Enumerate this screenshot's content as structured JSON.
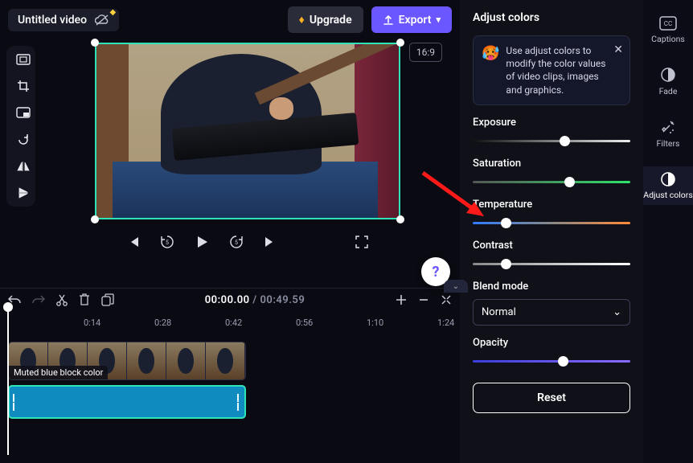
{
  "header": {
    "title": "Untitled video",
    "upgrade_label": "Upgrade",
    "export_label": "Export",
    "aspect_ratio": "16:9"
  },
  "timeline": {
    "current_time": "00:00.00",
    "total_time": "00:49.59",
    "separator": " / ",
    "ticks": [
      "0:14",
      "0:28",
      "0:42",
      "0:56",
      "1:10",
      "1:24"
    ],
    "clip_label": "Muted blue block color"
  },
  "panel": {
    "title": "Adjust colors",
    "info_emoji": "🥵",
    "info_text": "Use adjust colors to modify the color values of video clips, images and graphics.",
    "exposure": {
      "label": "Exposure",
      "value": 55
    },
    "saturation": {
      "label": "Saturation",
      "value": 58
    },
    "temperature": {
      "label": "Temperature",
      "value": 18
    },
    "contrast": {
      "label": "Contrast",
      "value": 18
    },
    "blend_label": "Blend mode",
    "blend_value": "Normal",
    "opacity": {
      "label": "Opacity",
      "value": 54
    },
    "reset_label": "Reset"
  },
  "rail": {
    "captions": "Captions",
    "fade": "Fade",
    "filters": "Filters",
    "adjust": "Adjust colors"
  }
}
